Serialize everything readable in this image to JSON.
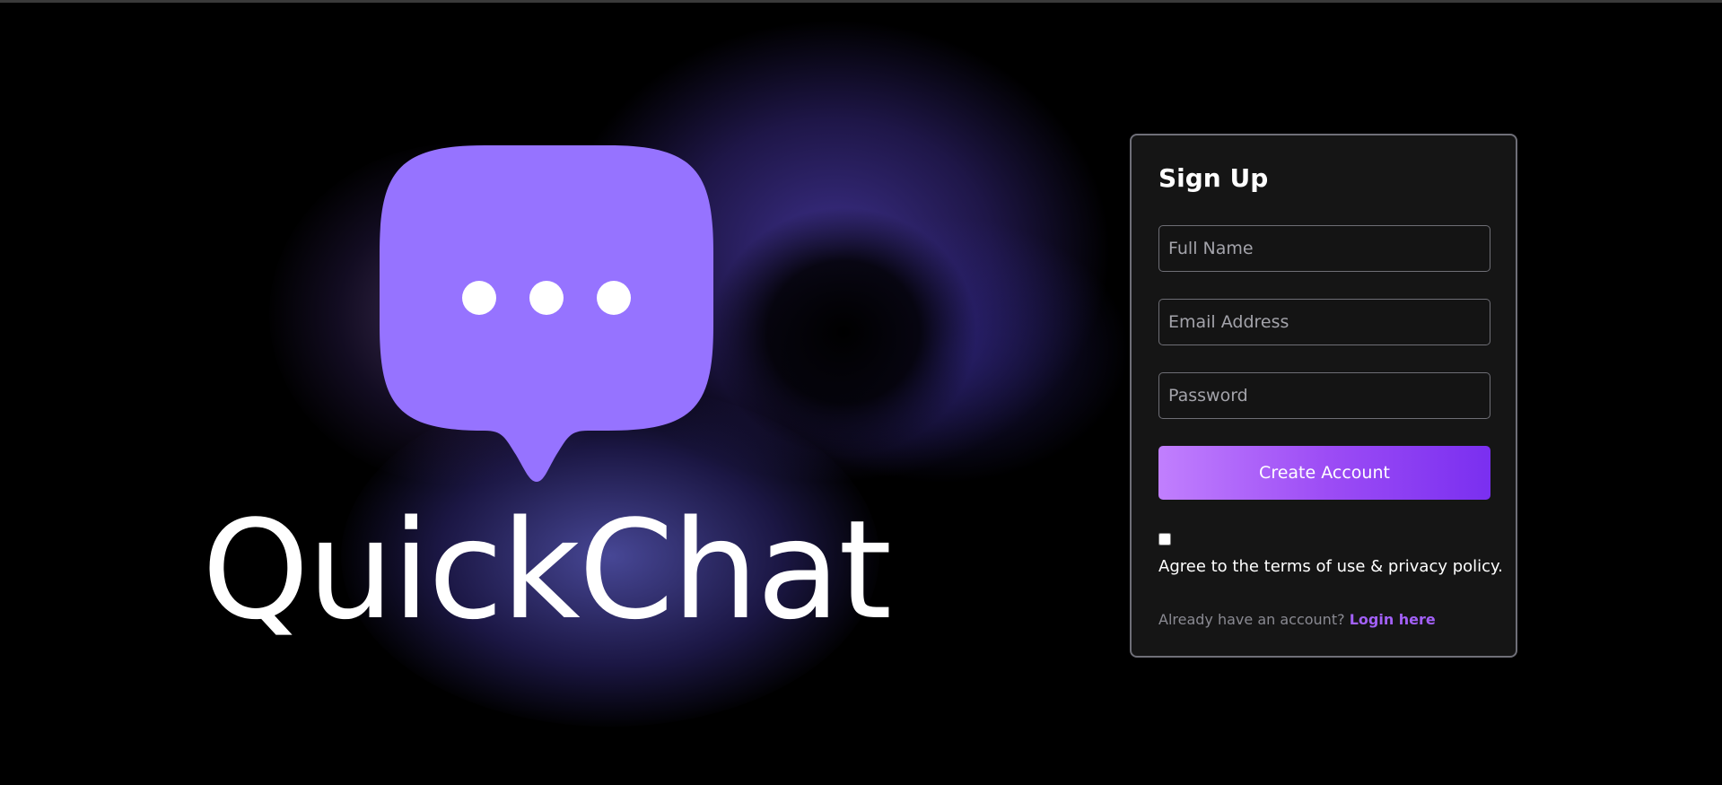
{
  "brand": {
    "name": "QuickChat",
    "logo_icon": "chat-bubble-ellipsis-icon",
    "logo_color": "#9673ff"
  },
  "signup": {
    "title": "Sign Up",
    "full_name_placeholder": "Full Name",
    "email_placeholder": "Email Address",
    "password_placeholder": "Password",
    "submit_label": "Create Account",
    "agree_checked": false,
    "agree_text": "Agree to the terms of use & privacy policy.",
    "login_prompt": "Already have an account?",
    "login_link": "Login here"
  },
  "colors": {
    "background": "#000000",
    "card": "#151515",
    "accent": "#9d4df5",
    "link": "#a260f7"
  }
}
